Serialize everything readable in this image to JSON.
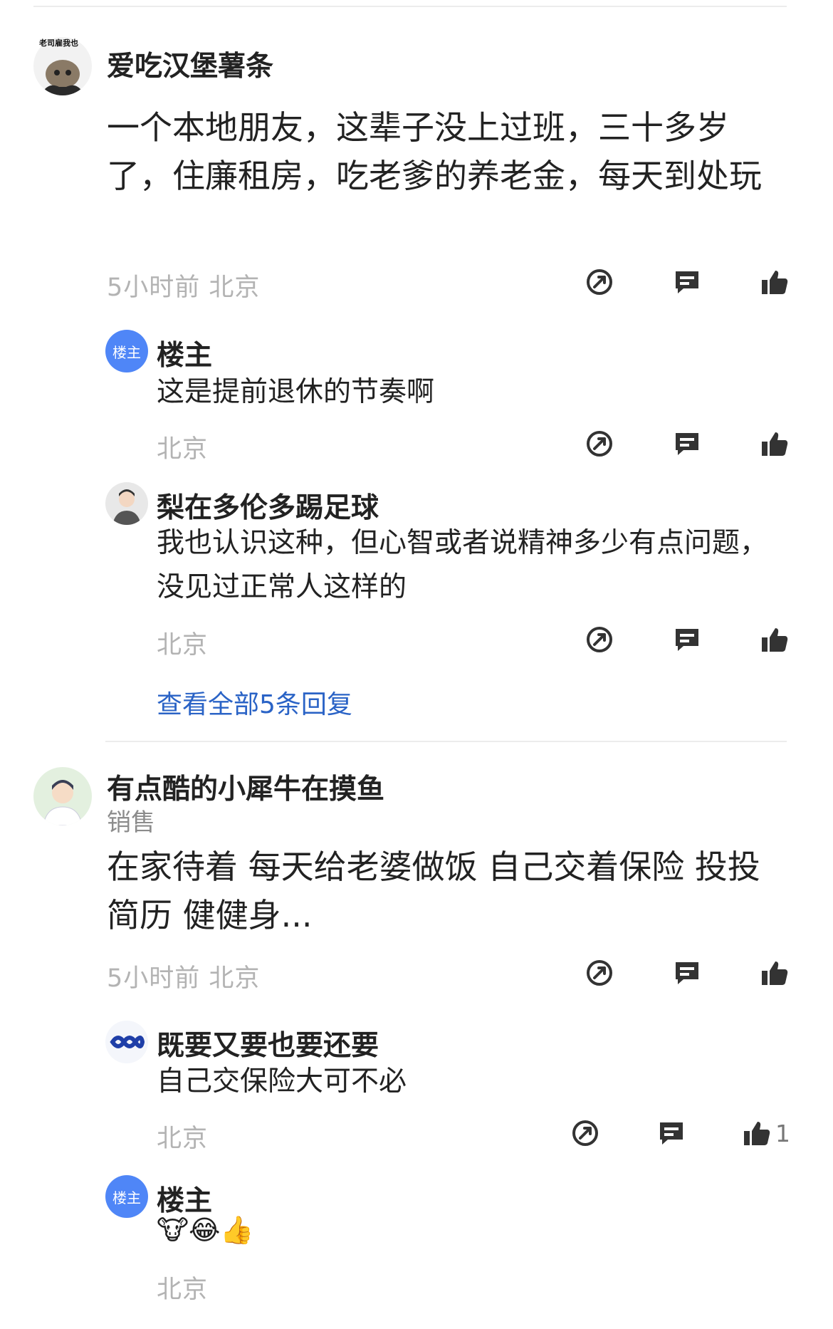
{
  "comments": [
    {
      "author": "爱吃汉堡薯条",
      "avatar_text": "老司雇我也",
      "text": "一个本地朋友，这辈子没上过班，三十多岁了，住廉租房，吃老爹的养老金，每天到处玩",
      "meta": "5小时前  北京",
      "replies": [
        {
          "author": "楼主",
          "badge": "楼主",
          "text": "这是提前退休的节奏啊",
          "meta": "北京"
        },
        {
          "author": "梨在多伦多踢足球",
          "text": "我也认识这种，但心智或者说精神多少有点问题，没见过正常人这样的",
          "meta": "北京"
        }
      ],
      "view_all": "查看全部5条回复"
    },
    {
      "author": "有点酷的小犀牛在摸鱼",
      "tag": "销售",
      "text": "在家待着 每天给老婆做饭 自己交着保险 投投简历 健健身...",
      "meta": "5小时前  北京",
      "replies": [
        {
          "author": "既要又要也要还要",
          "text": "自己交保险大可不必",
          "meta": "北京",
          "likes": "1"
        },
        {
          "author": "楼主",
          "badge": "楼主",
          "text": "🐮😂👍",
          "meta": "北京"
        }
      ]
    }
  ],
  "icons": {
    "share": "share-icon",
    "reply": "comment-icon",
    "like": "thumbs-up-icon"
  },
  "colors": {
    "link": "#2a63c6",
    "badge": "#4f86f7",
    "meta": "#b3b3b3",
    "icon": "#333333"
  }
}
